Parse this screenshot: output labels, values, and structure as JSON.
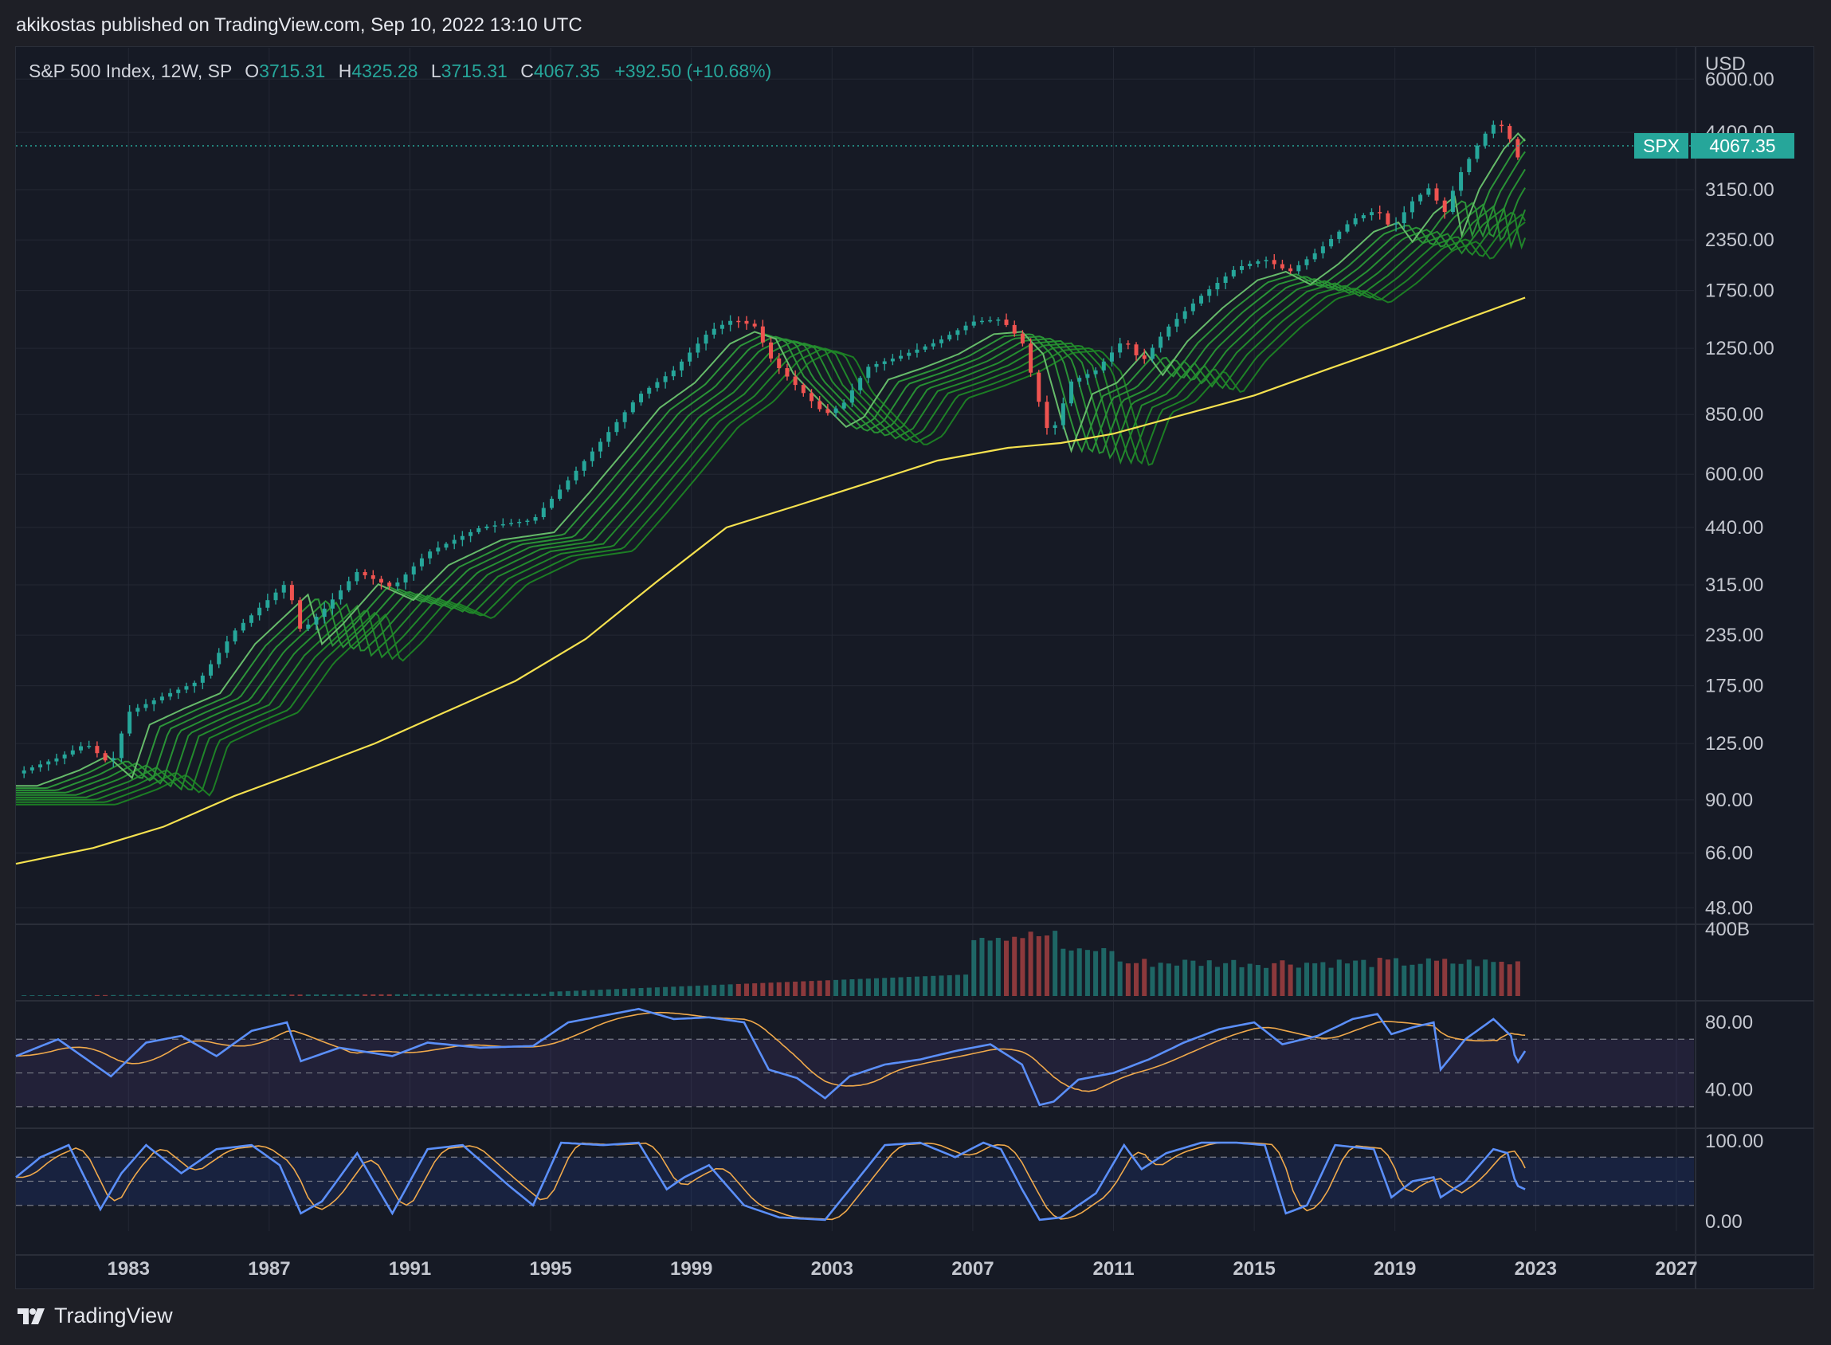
{
  "publish": {
    "text": "akikostas published on TradingView.com, Sep 10, 2022 13:10 UTC"
  },
  "legend": {
    "symbol_line": "S&P 500 Index, 12W, SP",
    "open_label": "O",
    "open_value": "3715.31",
    "high_label": "H",
    "high_value": "4325.28",
    "low_label": "L",
    "low_value": "3715.31",
    "close_label": "C",
    "close_value": "4067.35",
    "change": "+392.50 (+10.68%)"
  },
  "price_axis": {
    "currency": "USD",
    "ticks": [
      "6000.00",
      "4400.00",
      "3150.00",
      "2350.00",
      "1750.00",
      "1250.00",
      "850.00",
      "600.00",
      "440.00",
      "315.00",
      "235.00",
      "175.00",
      "125.00",
      "90.00",
      "66.00",
      "48.00"
    ],
    "current_tag_symbol": "SPX",
    "current_tag_value": "4067.35"
  },
  "volume_axis": {
    "ticks": [
      "400B"
    ]
  },
  "rsi_axis": {
    "ticks": [
      "80.00",
      "40.00"
    ]
  },
  "stoch_axis": {
    "ticks": [
      "100.00",
      "0.00"
    ]
  },
  "time_axis": {
    "ticks": [
      "1983",
      "1987",
      "1991",
      "1995",
      "1999",
      "2003",
      "2007",
      "2011",
      "2015",
      "2019",
      "2023",
      "2027"
    ]
  },
  "footer": {
    "brand": "TradingView"
  },
  "colors": {
    "up": "#26a69a",
    "down": "#ef5350",
    "ma_long": "#f5e14f",
    "ribbon": "#4caf50",
    "rsi_line": "#5b8ff9",
    "rsi_signal": "#f0a94b",
    "rsi_band": "#7e57c2",
    "stoch_band": "#2962ff"
  },
  "chart_data": {
    "type": "candlestick",
    "title": "S&P 500 Index, 12W, SP",
    "y_scale": "log",
    "ylim": [
      44,
      7200
    ],
    "x_range": [
      1979.8,
      2027.5
    ],
    "price_path": [
      [
        1979.8,
        105
      ],
      [
        1981,
        115
      ],
      [
        1981.8,
        125
      ],
      [
        1982.5,
        110
      ],
      [
        1983,
        150
      ],
      [
        1984,
        165
      ],
      [
        1985,
        180
      ],
      [
        1986,
        240
      ],
      [
        1987.5,
        320
      ],
      [
        1987.9,
        240
      ],
      [
        1988.5,
        270
      ],
      [
        1989.5,
        340
      ],
      [
        1990.5,
        310
      ],
      [
        1991.5,
        380
      ],
      [
        1993,
        440
      ],
      [
        1994.5,
        460
      ],
      [
        1995.5,
        580
      ],
      [
        1996.5,
        740
      ],
      [
        1997.5,
        950
      ],
      [
        1998.5,
        1100
      ],
      [
        1999.5,
        1380
      ],
      [
        2000.2,
        1480
      ],
      [
        2000.8,
        1420
      ],
      [
        2001.3,
        1160
      ],
      [
        2002,
        1000
      ],
      [
        2002.8,
        850
      ],
      [
        2003.3,
        900
      ],
      [
        2004,
        1120
      ],
      [
        2005,
        1200
      ],
      [
        2006,
        1300
      ],
      [
        2007,
        1460
      ],
      [
        2007.8,
        1480
      ],
      [
        2008.4,
        1300
      ],
      [
        2008.9,
        900
      ],
      [
        2009.2,
        740
      ],
      [
        2009.8,
        1030
      ],
      [
        2010.5,
        1100
      ],
      [
        2011.3,
        1320
      ],
      [
        2011.8,
        1150
      ],
      [
        2012.5,
        1400
      ],
      [
        2013.5,
        1700
      ],
      [
        2014.5,
        2000
      ],
      [
        2015.3,
        2100
      ],
      [
        2016,
        1950
      ],
      [
        2016.8,
        2200
      ],
      [
        2017.8,
        2650
      ],
      [
        2018.5,
        2800
      ],
      [
        2018.9,
        2500
      ],
      [
        2019.5,
        2950
      ],
      [
        2020.1,
        3250
      ],
      [
        2020.3,
        2600
      ],
      [
        2020.8,
        3400
      ],
      [
        2021.5,
        4300
      ],
      [
        2021.9,
        4700
      ],
      [
        2022.2,
        4400
      ],
      [
        2022.45,
        3750
      ],
      [
        2022.7,
        4067.35
      ]
    ],
    "long_ma_path": [
      [
        1979.8,
        62
      ],
      [
        1982,
        68
      ],
      [
        1984,
        77
      ],
      [
        1986,
        92
      ],
      [
        1988,
        107
      ],
      [
        1990,
        125
      ],
      [
        1992,
        150
      ],
      [
        1994,
        180
      ],
      [
        1996,
        230
      ],
      [
        1998,
        320
      ],
      [
        2000,
        440
      ],
      [
        2002,
        500
      ],
      [
        2004,
        570
      ],
      [
        2006,
        650
      ],
      [
        2008,
        700
      ],
      [
        2009.5,
        720
      ],
      [
        2011,
        760
      ],
      [
        2013,
        850
      ],
      [
        2015,
        950
      ],
      [
        2017,
        1100
      ],
      [
        2019,
        1270
      ],
      [
        2021,
        1480
      ],
      [
        2022.7,
        1680
      ]
    ],
    "ribbon_count": 9,
    "volume_note": "volume bars on separate pane, max label 400B",
    "rsi": {
      "upper_band": 70,
      "lower_band": 30,
      "y_labels": [
        80,
        40
      ],
      "path": [
        [
          1979.8,
          60
        ],
        [
          1981,
          70
        ],
        [
          1982.5,
          48
        ],
        [
          1983.5,
          68
        ],
        [
          1984.5,
          72
        ],
        [
          1985.5,
          60
        ],
        [
          1986.5,
          75
        ],
        [
          1987.5,
          80
        ],
        [
          1987.9,
          57
        ],
        [
          1989,
          65
        ],
        [
          1990.5,
          60
        ],
        [
          1991.5,
          68
        ],
        [
          1993,
          65
        ],
        [
          1994.5,
          66
        ],
        [
          1995.5,
          80
        ],
        [
          1996.5,
          84
        ],
        [
          1997.5,
          88
        ],
        [
          1998.5,
          82
        ],
        [
          1999.5,
          83
        ],
        [
          2000.5,
          80
        ],
        [
          2001.2,
          52
        ],
        [
          2002,
          47
        ],
        [
          2002.8,
          35
        ],
        [
          2003.5,
          48
        ],
        [
          2004.5,
          55
        ],
        [
          2005.5,
          58
        ],
        [
          2006.5,
          63
        ],
        [
          2007.5,
          67
        ],
        [
          2008.4,
          55
        ],
        [
          2008.9,
          31
        ],
        [
          2009.3,
          33
        ],
        [
          2010,
          46
        ],
        [
          2011,
          50
        ],
        [
          2012,
          58
        ],
        [
          2013,
          68
        ],
        [
          2014,
          76
        ],
        [
          2015,
          80
        ],
        [
          2015.8,
          67
        ],
        [
          2016.8,
          72
        ],
        [
          2017.8,
          82
        ],
        [
          2018.5,
          85
        ],
        [
          2018.9,
          73
        ],
        [
          2019.5,
          77
        ],
        [
          2020.1,
          80
        ],
        [
          2020.3,
          52
        ],
        [
          2021,
          70
        ],
        [
          2021.8,
          82
        ],
        [
          2022.3,
          72
        ],
        [
          2022.45,
          55
        ],
        [
          2022.7,
          63
        ]
      ]
    },
    "stoch": {
      "upper_band": 80,
      "lower_band": 20,
      "y_labels": [
        100,
        0
      ],
      "path": [
        [
          1979.8,
          55
        ],
        [
          1980.5,
          80
        ],
        [
          1981.3,
          95
        ],
        [
          1982.2,
          15
        ],
        [
          1982.8,
          60
        ],
        [
          1983.5,
          95
        ],
        [
          1984.5,
          60
        ],
        [
          1985.5,
          90
        ],
        [
          1986.5,
          95
        ],
        [
          1987.3,
          70
        ],
        [
          1987.9,
          10
        ],
        [
          1988.5,
          25
        ],
        [
          1989.5,
          85
        ],
        [
          1990.5,
          10
        ],
        [
          1991.5,
          90
        ],
        [
          1992.5,
          95
        ],
        [
          1993.8,
          45
        ],
        [
          1994.5,
          20
        ],
        [
          1995.3,
          98
        ],
        [
          1996.5,
          95
        ],
        [
          1997.5,
          98
        ],
        [
          1998.3,
          40
        ],
        [
          1998.8,
          55
        ],
        [
          1999.5,
          70
        ],
        [
          2000.5,
          20
        ],
        [
          2001.5,
          5
        ],
        [
          2002.8,
          2
        ],
        [
          2003.5,
          40
        ],
        [
          2004.5,
          95
        ],
        [
          2005.5,
          98
        ],
        [
          2006.5,
          80
        ],
        [
          2007.3,
          98
        ],
        [
          2007.8,
          90
        ],
        [
          2008.4,
          40
        ],
        [
          2008.9,
          2
        ],
        [
          2009.5,
          5
        ],
        [
          2010.5,
          35
        ],
        [
          2011.3,
          95
        ],
        [
          2011.8,
          65
        ],
        [
          2012.5,
          85
        ],
        [
          2013.5,
          98
        ],
        [
          2014.5,
          98
        ],
        [
          2015.3,
          95
        ],
        [
          2015.9,
          10
        ],
        [
          2016.5,
          20
        ],
        [
          2017.3,
          95
        ],
        [
          2018.4,
          90
        ],
        [
          2018.9,
          30
        ],
        [
          2019.5,
          50
        ],
        [
          2020.1,
          55
        ],
        [
          2020.3,
          30
        ],
        [
          2021,
          50
        ],
        [
          2021.8,
          90
        ],
        [
          2022.2,
          85
        ],
        [
          2022.45,
          45
        ],
        [
          2022.7,
          40
        ]
      ]
    }
  }
}
